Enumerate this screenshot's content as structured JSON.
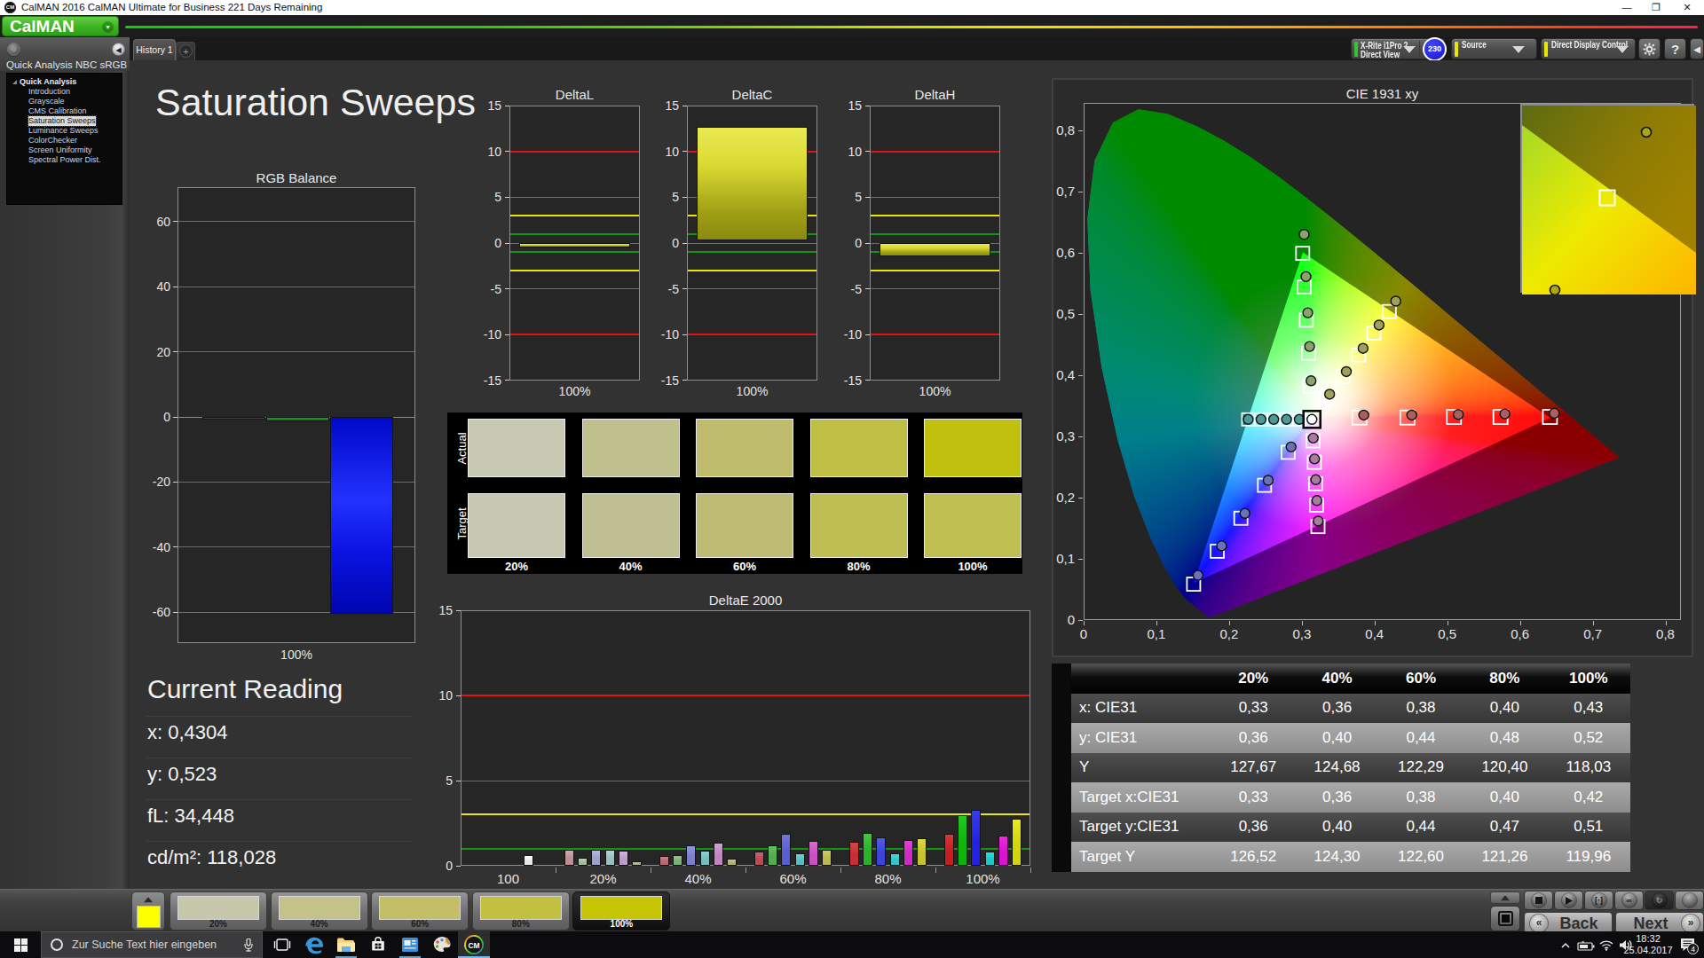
{
  "window": {
    "title": "CalMAN 2016 CalMAN Ultimate for Business 221 Days Remaining"
  },
  "logo": {
    "text": "CalMAN"
  },
  "tabs": {
    "history_label": "History 1",
    "add_label": "+"
  },
  "toolbar": {
    "meter_line1": "X-Rite i1Pro 2",
    "meter_line2": "Direct View",
    "meter_badge": "230",
    "source_label": "Source",
    "ddc_label": "Direct Display Control",
    "help_label": "?"
  },
  "sidebar": {
    "workflow_label": "Quick Analysis NBC sRGB",
    "tree": [
      {
        "label": "Quick Analysis",
        "level": 0,
        "bold": true,
        "selected": false
      },
      {
        "label": "Introduction",
        "level": 1,
        "bold": false,
        "selected": false
      },
      {
        "label": "Grayscale",
        "level": 1,
        "bold": false,
        "selected": false
      },
      {
        "label": "CMS Calibration",
        "level": 1,
        "bold": false,
        "selected": false
      },
      {
        "label": "Saturation Sweeps",
        "level": 1,
        "bold": false,
        "selected": true
      },
      {
        "label": "Luminance Sweeps",
        "level": 1,
        "bold": false,
        "selected": false
      },
      {
        "label": "ColorChecker",
        "level": 1,
        "bold": false,
        "selected": false
      },
      {
        "label": "Screen Uniformity",
        "level": 1,
        "bold": false,
        "selected": false
      },
      {
        "label": "Spectral Power Dist.",
        "level": 1,
        "bold": false,
        "selected": false
      }
    ]
  },
  "page": {
    "title": "Saturation Sweeps"
  },
  "current_reading": {
    "title": "Current Reading",
    "items": [
      {
        "key": "x",
        "text": "x: 0,4304"
      },
      {
        "key": "y",
        "text": "y: 0,523"
      },
      {
        "key": "fL",
        "text": "fL: 34,448"
      },
      {
        "key": "cdm2",
        "text": "cd/m²: 118,028"
      }
    ]
  },
  "swatch_grid": {
    "row_labels": [
      "Actual",
      "Target"
    ],
    "columns": [
      {
        "label": "20%",
        "actual": "#c7c9b2",
        "target": "#c6c8b1"
      },
      {
        "label": "40%",
        "actual": "#c0c08e",
        "target": "#bfbf92"
      },
      {
        "label": "60%",
        "actual": "#bfbc6d",
        "target": "#bebc74"
      },
      {
        "label": "80%",
        "actual": "#c0bf45",
        "target": "#bfbe52"
      },
      {
        "label": "100%",
        "actual": "#c2c00e",
        "target": "#c0bf52"
      }
    ]
  },
  "chart_data": {
    "rgb_balance": {
      "type": "bar",
      "title": "RGB Balance",
      "xlabel": "100%",
      "ylim": [
        -70,
        70
      ],
      "yticks": [
        60,
        40,
        20,
        0,
        -20,
        -40,
        -60
      ],
      "series": [
        {
          "name": "red",
          "value": -0.9,
          "gradient": "linear-gradient(180deg,#d02020,#8c0c0c)"
        },
        {
          "name": "green",
          "value": -1.4,
          "gradient": "linear-gradient(180deg,#20a020,#0c700c)"
        },
        {
          "name": "blue",
          "value": -60.5,
          "gradient": "linear-gradient(180deg,#0008c8 0%,#2232ff 42%,#0a12e0 70%,#0006b0 100%)"
        }
      ]
    },
    "deltaL": {
      "type": "bar",
      "title": "DeltaL",
      "xlabel": "100%",
      "ylim": [
        -15,
        15
      ],
      "yticks": [
        15,
        10,
        5,
        0,
        -5,
        -10,
        -15
      ],
      "value": -0.45,
      "base": 0,
      "limits": {
        "red": 10,
        "yellow": 3,
        "green": 1
      }
    },
    "deltaC": {
      "type": "bar",
      "title": "DeltaC",
      "xlabel": "100%",
      "ylim": [
        -15,
        15
      ],
      "yticks": [
        15,
        10,
        5,
        0,
        -5,
        -10,
        -15
      ],
      "value": 12.7,
      "base": 0.25,
      "limits": {
        "red": 10,
        "yellow": 3,
        "green": 1
      }
    },
    "deltaH": {
      "type": "bar",
      "title": "DeltaH",
      "xlabel": "100%",
      "ylim": [
        -15,
        15
      ],
      "yticks": [
        15,
        10,
        5,
        0,
        -5,
        -10,
        -15
      ],
      "value": -1.45,
      "base": 0,
      "limits": {
        "red": 10,
        "yellow": 3,
        "green": 1
      }
    },
    "deltaE2000": {
      "type": "bar",
      "title": "DeltaE 2000",
      "ylim": [
        0,
        15
      ],
      "yticks": [
        15,
        10,
        5,
        0
      ],
      "limits": {
        "red": 10,
        "yellow": 3,
        "green": 1
      },
      "groups": [
        {
          "label": "100",
          "bars": [
            {
              "slot": 4,
              "value": 0.62,
              "color": "#e8e8e8",
              "color2": "#ffffff"
            }
          ]
        },
        {
          "label": "20%",
          "bars": [
            {
              "slot": 0,
              "value": 0.95,
              "color": "#c08e92",
              "color2": "#d4a6aa"
            },
            {
              "slot": 1,
              "value": 0.45,
              "color": "#a4bc9c",
              "color2": "#bcd0b4"
            },
            {
              "slot": 2,
              "value": 0.92,
              "color": "#9ea2cc",
              "color2": "#b6bade"
            },
            {
              "slot": 3,
              "value": 0.92,
              "color": "#98c0c0",
              "color2": "#b0d4d4"
            },
            {
              "slot": 4,
              "value": 0.9,
              "color": "#bc9ec8",
              "color2": "#d0b6da"
            },
            {
              "slot": 5,
              "value": 0.25,
              "color": "#b2b290",
              "color2": "#c8c8a8"
            }
          ]
        },
        {
          "label": "40%",
          "bars": [
            {
              "slot": 0,
              "value": 0.55,
              "color": "#b96a70",
              "color2": "#cd8288"
            },
            {
              "slot": 1,
              "value": 0.62,
              "color": "#7cb274",
              "color2": "#94c68c"
            },
            {
              "slot": 2,
              "value": 1.22,
              "color": "#7c7ecc",
              "color2": "#9496de"
            },
            {
              "slot": 3,
              "value": 0.87,
              "color": "#78bcbe",
              "color2": "#90d0d2"
            },
            {
              "slot": 4,
              "value": 1.38,
              "color": "#c284c4",
              "color2": "#d69cd6"
            },
            {
              "slot": 5,
              "value": 0.44,
              "color": "#b4b272",
              "color2": "#c8c68a"
            }
          ]
        },
        {
          "label": "60%",
          "bars": [
            {
              "slot": 0,
              "value": 0.83,
              "color": "#bc4a52",
              "color2": "#d0626a"
            },
            {
              "slot": 1,
              "value": 1.18,
              "color": "#50ac4c",
              "color2": "#68c064"
            },
            {
              "slot": 2,
              "value": 1.85,
              "color": "#585ed2",
              "color2": "#7076e0"
            },
            {
              "slot": 3,
              "value": 0.75,
              "color": "#56bec2",
              "color2": "#6ed2d6"
            },
            {
              "slot": 4,
              "value": 1.44,
              "color": "#c852c0",
              "color2": "#da6ad2"
            },
            {
              "slot": 5,
              "value": 0.95,
              "color": "#bab84e",
              "color2": "#cecc66"
            }
          ]
        },
        {
          "label": "80%",
          "bars": [
            {
              "slot": 0,
              "value": 1.43,
              "color": "#c42e34",
              "color2": "#d84648"
            },
            {
              "slot": 1,
              "value": 1.95,
              "color": "#2ab428",
              "color2": "#42c840"
            },
            {
              "slot": 2,
              "value": 1.68,
              "color": "#3a44da",
              "color2": "#525ce8"
            },
            {
              "slot": 3,
              "value": 0.75,
              "color": "#36c4c6",
              "color2": "#4ed8da"
            },
            {
              "slot": 4,
              "value": 1.52,
              "color": "#d02ac4",
              "color2": "#e242d6"
            },
            {
              "slot": 5,
              "value": 1.62,
              "color": "#c6c42c",
              "color2": "#dad844"
            }
          ]
        },
        {
          "label": "100%",
          "bars": [
            {
              "slot": 0,
              "value": 1.9,
              "color": "#c81e22",
              "color2": "#dc3636"
            },
            {
              "slot": 1,
              "value": 2.95,
              "color": "#0cb40c",
              "color2": "#24c824"
            },
            {
              "slot": 2,
              "value": 3.3,
              "color": "#2222e4",
              "color2": "#3a3af2"
            },
            {
              "slot": 3,
              "value": 0.83,
              "color": "#16caca",
              "color2": "#2edede"
            },
            {
              "slot": 4,
              "value": 1.77,
              "color": "#da14cc",
              "color2": "#ec2cde"
            },
            {
              "slot": 5,
              "value": 2.78,
              "color": "#d4d40a",
              "color2": "#e8e822"
            }
          ]
        }
      ]
    },
    "cie": {
      "type": "scatter",
      "title": "CIE 1931 xy",
      "xlim": [
        0,
        0.8
      ],
      "ylim": [
        0,
        0.8
      ],
      "ticks": [
        {
          "v": 0.0,
          "label": "0"
        },
        {
          "v": 0.1,
          "label": "0,1"
        },
        {
          "v": 0.2,
          "label": "0,2"
        },
        {
          "v": 0.3,
          "label": "0,3"
        },
        {
          "v": 0.4,
          "label": "0,4"
        },
        {
          "v": 0.5,
          "label": "0,5"
        },
        {
          "v": 0.6,
          "label": "0,6"
        },
        {
          "v": 0.7,
          "label": "0,7"
        },
        {
          "v": 0.8,
          "label": "0,8"
        }
      ],
      "white_point": [
        0.3127,
        0.329
      ],
      "gamut_triangle": [
        [
          0.64,
          0.33
        ],
        [
          0.3,
          0.6
        ],
        [
          0.15,
          0.06
        ]
      ],
      "sweeps": [
        {
          "name": "red",
          "dot": "#a86060",
          "square": 16,
          "targets": [
            [
              0.378,
              0.332
            ],
            [
              0.444,
              0.332
            ],
            [
              0.508,
              0.333
            ],
            [
              0.572,
              0.333
            ],
            [
              0.64,
              0.333
            ]
          ],
          "measured": [
            [
              0.384,
              0.336
            ],
            [
              0.45,
              0.336
            ],
            [
              0.514,
              0.337
            ],
            [
              0.578,
              0.338
            ],
            [
              0.646,
              0.339
            ]
          ]
        },
        {
          "name": "green",
          "dot": "#88a468",
          "square": 15,
          "targets": [
            [
              0.3105,
              0.383
            ],
            [
              0.308,
              0.437
            ],
            [
              0.305,
              0.491
            ],
            [
              0.302,
              0.545
            ],
            [
              0.3,
              0.6
            ]
          ],
          "measured": [
            [
              0.3115,
              0.392
            ],
            [
              0.3095,
              0.448
            ],
            [
              0.307,
              0.503
            ],
            [
              0.3045,
              0.562
            ],
            [
              0.302,
              0.631
            ]
          ]
        },
        {
          "name": "blue",
          "dot": "#6872b4",
          "square": 15,
          "targets": [
            [
              0.28,
              0.2752
            ],
            [
              0.2475,
              0.2214
            ],
            [
              0.215,
              0.1676
            ],
            [
              0.1825,
              0.1138
            ],
            [
              0.15,
              0.06
            ]
          ],
          "measured": [
            [
              0.284,
              0.284
            ],
            [
              0.2525,
              0.2295
            ],
            [
              0.2205,
              0.1755
            ],
            [
              0.1885,
              0.1225
            ],
            [
              0.156,
              0.0745
            ]
          ]
        },
        {
          "name": "cyan",
          "dot": "#4e9898",
          "square": 14,
          "targets": [
            [
              0.2953,
              0.329
            ],
            [
              0.2778,
              0.329
            ],
            [
              0.2602,
              0.329
            ],
            [
              0.2427,
              0.329
            ],
            [
              0.2251,
              0.329
            ]
          ],
          "measured": [
            [
              0.2953,
              0.329
            ],
            [
              0.2778,
              0.329
            ],
            [
              0.2602,
              0.329
            ],
            [
              0.2427,
              0.329
            ],
            [
              0.2251,
              0.329
            ]
          ]
        },
        {
          "name": "magenta",
          "dot": "#a87ca0",
          "square": 15,
          "targets": [
            [
              0.3143,
              0.294
            ],
            [
              0.316,
              0.259
            ],
            [
              0.3177,
              0.224
            ],
            [
              0.319,
              0.189
            ],
            [
              0.321,
              0.154
            ]
          ],
          "measured": [
            [
              0.3145,
              0.2985
            ],
            [
              0.3163,
              0.2645
            ],
            [
              0.318,
              0.2305
            ],
            [
              0.3195,
              0.1965
            ],
            [
              0.3213,
              0.163
            ]
          ]
        },
        {
          "name": "yellow",
          "dot": "#a0a05c",
          "square": 15,
          "targets": [
            [
              0.334,
              0.364
            ],
            [
              0.3555,
              0.399
            ],
            [
              0.377,
              0.434
            ],
            [
              0.398,
              0.47
            ],
            [
              0.419,
              0.505
            ]
          ],
          "measured": [
            [
              0.337,
              0.37
            ],
            [
              0.36,
              0.407
            ],
            [
              0.383,
              0.445
            ],
            [
              0.405,
              0.483
            ],
            [
              0.428,
              0.522
            ]
          ]
        }
      ],
      "inset": {
        "square": [
          96,
          104
        ],
        "dots": [
          [
            140,
            30
          ],
          [
            37,
            208
          ]
        ]
      }
    }
  },
  "table": {
    "columns": [
      "20%",
      "40%",
      "60%",
      "80%",
      "100%"
    ],
    "rows": [
      {
        "label": "x: CIE31",
        "values": [
          "0,33",
          "0,36",
          "0,38",
          "0,40",
          "0,43"
        ]
      },
      {
        "label": "y: CIE31",
        "values": [
          "0,36",
          "0,40",
          "0,44",
          "0,48",
          "0,52"
        ]
      },
      {
        "label": "Y",
        "values": [
          "127,67",
          "124,68",
          "122,29",
          "120,40",
          "118,03"
        ]
      },
      {
        "label": "Target x:CIE31",
        "values": [
          "0,33",
          "0,36",
          "0,38",
          "0,40",
          "0,42"
        ]
      },
      {
        "label": "Target y:CIE31",
        "values": [
          "0,36",
          "0,40",
          "0,44",
          "0,47",
          "0,51"
        ]
      },
      {
        "label": "Target Y",
        "values": [
          "126,52",
          "124,30",
          "122,60",
          "121,26",
          "119,96"
        ]
      }
    ]
  },
  "bottom_bar": {
    "current_color": "#feff00",
    "slots": [
      {
        "label": "20%",
        "color": "#c6c7ac",
        "selected": false
      },
      {
        "label": "40%",
        "color": "#c2c289",
        "selected": false
      },
      {
        "label": "60%",
        "color": "#c2bf66",
        "selected": false
      },
      {
        "label": "80%",
        "color": "#c2c040",
        "selected": false
      },
      {
        "label": "100%",
        "color": "#c6c606",
        "selected": true
      }
    ],
    "buttons": [
      {
        "name": "stop-button",
        "glyph": "",
        "glyph_svg": "stop",
        "dark": false
      },
      {
        "name": "play-button",
        "glyph": "",
        "glyph_svg": "play",
        "dark": false
      },
      {
        "name": "frame-button",
        "glyph": "[·]",
        "dark": false
      },
      {
        "name": "loop-button",
        "glyph": "∞",
        "dark": false
      },
      {
        "name": "refresh-button",
        "glyph": "↻",
        "dark": true
      },
      {
        "name": "blank-button",
        "glyph": "",
        "dark": false
      }
    ],
    "back_label": "Back",
    "next_label": "Next"
  },
  "taskbar": {
    "search_placeholder": "Zur Suche Text hier eingeben",
    "time": "18:32",
    "date": "25.04.2017",
    "notification_count": "4",
    "apps": [
      {
        "name": "task-view",
        "icon": "taskview",
        "x": 300,
        "running": false,
        "active": false
      },
      {
        "name": "edge",
        "icon": "edge",
        "x": 336,
        "running": false,
        "active": false
      },
      {
        "name": "explorer",
        "icon": "folder",
        "x": 372,
        "running": true,
        "active": false
      },
      {
        "name": "store",
        "icon": "store",
        "x": 408,
        "running": false,
        "active": false
      },
      {
        "name": "news",
        "icon": "news",
        "x": 444,
        "running": true,
        "active": false
      },
      {
        "name": "paint",
        "icon": "paint",
        "x": 480,
        "running": false,
        "active": false
      },
      {
        "name": "calman",
        "icon": "cm",
        "x": 516,
        "running": true,
        "active": true
      }
    ]
  }
}
